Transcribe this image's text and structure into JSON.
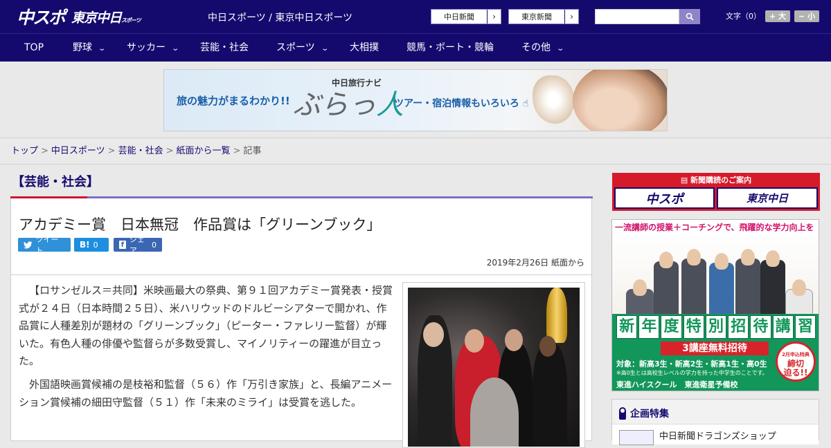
{
  "header": {
    "logo_chuspo": "中スポ",
    "logo_tokyo": "東京中日",
    "logo_tokyo_suffix": "スポーツ",
    "site_names": "中日スポーツ / 東京中日スポーツ",
    "links": [
      {
        "label": "中日新聞",
        "arrow": "›"
      },
      {
        "label": "東京新聞",
        "arrow": "›"
      }
    ],
    "search": {
      "value": "",
      "placeholder": ""
    },
    "font_size": {
      "label": "文字（0）",
      "bigger": "+ 大",
      "smaller": "− 小"
    }
  },
  "nav": {
    "items": [
      {
        "label": "TOP",
        "dropdown": false
      },
      {
        "label": "野球",
        "dropdown": true
      },
      {
        "label": "サッカー",
        "dropdown": true
      },
      {
        "label": "芸能・社会",
        "dropdown": false
      },
      {
        "label": "スポーツ",
        "dropdown": true
      },
      {
        "label": "大相撲",
        "dropdown": false
      },
      {
        "label": "競馬・ボート・競輪",
        "dropdown": false
      },
      {
        "label": "その他",
        "dropdown": true
      }
    ]
  },
  "ad_banner": {
    "left": "旅の魅力がまるわかり!!",
    "small": "中日旅行ナビ",
    "big_a": "ぶらっ",
    "big_b": "人",
    "right": "ツアー・宿泊情報もいろいろ"
  },
  "breadcrumb": {
    "items": [
      "トップ",
      "中日スポーツ",
      "芸能・社会",
      "紙面から一覧"
    ],
    "current": "記事",
    "separator": ">"
  },
  "article": {
    "section": "【芸能・社会】",
    "headline": "アカデミー賞　日本無冠　作品賞は「グリーンブック」",
    "share": {
      "twitter": "ツイート",
      "hatena_icon": "B!",
      "hatena_count": "0",
      "facebook_icon": "f",
      "facebook_label": "シェア",
      "facebook_count": "0"
    },
    "dateline": "2019年2月26日 紙面から",
    "paragraphs": [
      "【ロサンゼルス＝共同】米映画最大の祭典、第９１回アカデミー賞発表・授賞式が２４日（日本時間２５日）、米ハリウッドのドルビーシアターで開かれ、作品賞に人種差別が題材の「グリーンブック」（ピーター・ファレリー監督）が輝いた。有色人種の俳優や監督らが多数受賞し、マイノリティーの躍進が目立った。",
      "外国語映画賞候補の是枝裕和監督（５６）作「万引き家族」と、長編アニメーション賞候補の細田守監督（５１）作「未来のミライ」は受賞を逃した。"
    ]
  },
  "sidebar": {
    "subscribe": {
      "title": "新聞購読のご案内",
      "left": "中スポ",
      "right": "東京中日"
    },
    "toshin_ad": {
      "top": "一流講師の授業＋コーチングで、飛躍的な学力向上を",
      "big_chars": [
        "新",
        "年",
        "度",
        "特",
        "別",
        "招",
        "待",
        "講",
        "習"
      ],
      "red": "3講座無料招待",
      "target": "対象：新高3生・新高2生・新高1生・高0生",
      "note": "※高0生とは高校生レベルの学力を持った中学生のことです。",
      "schools": "東進ハイスクール　東進衛星予備校",
      "badge_lines": [
        "2月申込特典",
        "締切",
        "迫る!!"
      ]
    },
    "kikaku": {
      "title": "企画特集",
      "item": "中日新聞ドラゴンズショップ"
    }
  },
  "colors": {
    "brand_navy": "#140a6e",
    "accent_red": "#d1112b",
    "accent_purple": "#7a70c4",
    "twitter": "#2f91d7",
    "hatena": "#1e8ee0",
    "facebook": "#3b66b3",
    "toshin_green": "#12965a"
  },
  "icons": [
    "search-icon",
    "chevron-down-icon",
    "twitter-icon",
    "hatena-icon",
    "facebook-icon",
    "ribbon-icon",
    "newspaper-icon"
  ]
}
